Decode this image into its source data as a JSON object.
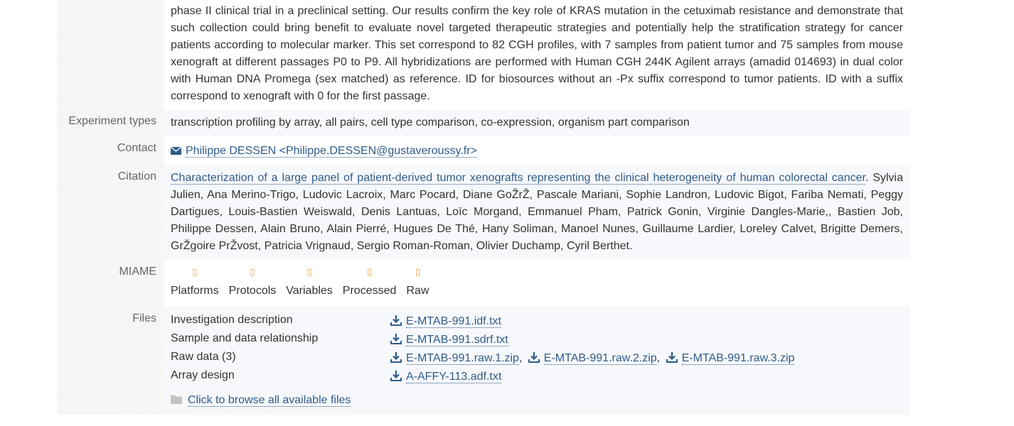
{
  "description": {
    "text": "phase II clinical trial in a preclinical setting. Our results confirm the key role of KRAS mutation in the cetuximab resistance and demonstrate that such collection could bring benefit to evaluate novel targeted therapeutic strategies and potentially help the stratification strategy for cancer patients according to molecular marker. This set correspond to 82 CGH profiles, with 7 samples from patient tumor and 75 samples from mouse xenograft at different passages P0 to P9. All hybridizations are performed with Human CGH 244K Agilent arrays (amadid 014693) in dual color with Human DNA Promega (sex matched) as reference. ID for biosources without an -Px suffix correspond to tumor patients. ID with a suffix correspond to xenograft with 0 for the first passage."
  },
  "experiment_types": {
    "label": "Experiment types",
    "value": "transcription profiling by array, all pairs, cell type comparison, co-expression, organism part comparison"
  },
  "contact": {
    "label": "Contact",
    "value": "Philippe DESSEN <Philippe.DESSEN@gustaveroussy.fr>",
    "icon": "envelope-icon"
  },
  "citation": {
    "label": "Citation",
    "title": "Characterization of a large panel of patient-derived tumor xenografts representing the clinical heterogeneity of human colorectal cancer",
    "authors": ". Sylvia Julien, Ana Merino-Trigo, Ludovic Lacroix, Marc Pocard, Diane GoŽrŽ, Pascale Mariani, Sophie Landron, Ludovic Bigot, Fariba Nemati, Peggy Dartigues, Louis-Bastien Weiswald, Denis Lantuas, Loïc Morgand, Emmanuel Pham, Patrick Gonin, Virginie Dangles-Marie,, Bastien Job, Philippe Dessen, Alain Bruno, Alain Pierré, Hugues De Thé, Hany Soliman, Manoel Nunes, Guillaume Lardier, Loreley Calvet, Brigitte Demers, GrŽgoire PrŽvost, Patricia Vrignaud, Sergio Roman-Roman, Olivier Duchamp, Cyril Berthet."
  },
  "miame": {
    "label": "MIAME",
    "icon_glyph": "▯",
    "icon_color": "#e8a246",
    "items": [
      {
        "label": "Platforms"
      },
      {
        "label": "Protocols"
      },
      {
        "label": "Variables"
      },
      {
        "label": "Processed"
      },
      {
        "label": "Raw"
      }
    ]
  },
  "files": {
    "label": "Files",
    "rows": [
      {
        "name": "Investigation description",
        "links": [
          "E-MTAB-991.idf.txt"
        ]
      },
      {
        "name": "Sample and data relationship",
        "links": [
          "E-MTAB-991.sdrf.txt"
        ]
      },
      {
        "name": "Raw data (3)",
        "links": [
          "E-MTAB-991.raw.1.zip",
          "E-MTAB-991.raw.2.zip",
          "E-MTAB-991.raw.3.zip"
        ],
        "separator": ","
      },
      {
        "name": "Array design",
        "links": [
          "A-AFFY-113.adf.txt"
        ]
      }
    ],
    "browse": "Click to browse all available files"
  },
  "colors": {
    "link": "#2f5c8a",
    "label": "#666666",
    "row_shade": "#f7f8fb"
  }
}
